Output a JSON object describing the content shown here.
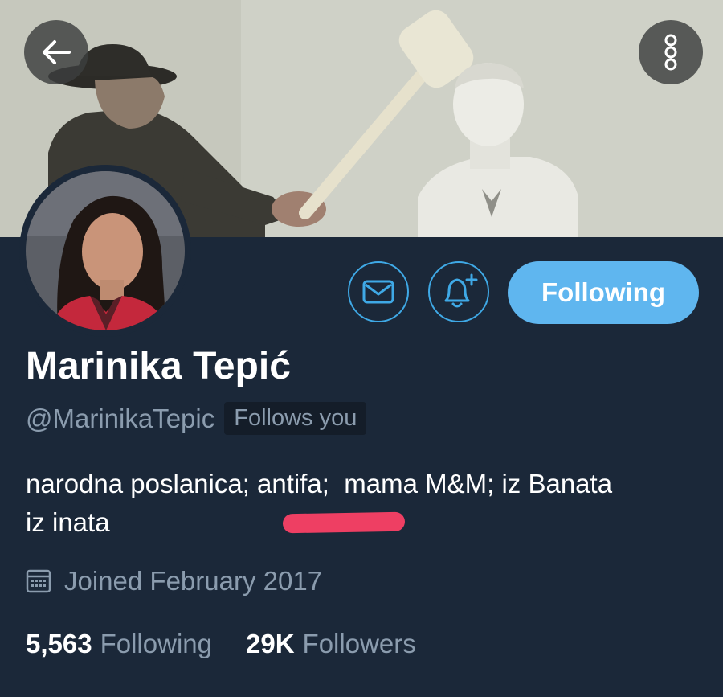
{
  "profile": {
    "name": "Marinika Tepić",
    "handle": "@MarinikaTepic",
    "follows_you": "Follows you",
    "bio": "narodna poslanica; antifa;  mama M&M; iz Banata\niz inata",
    "joined": "Joined February 2017"
  },
  "stats": {
    "following_count": "5,563",
    "following_label": "Following",
    "followers_count": "29K",
    "followers_label": "Followers"
  },
  "actions": {
    "follow_state_label": "Following"
  },
  "icons": {
    "back": "arrow-left-icon",
    "more": "more-vertical-icon",
    "message": "envelope-icon",
    "notify": "bell-plus-icon",
    "calendar": "calendar-icon"
  },
  "colors": {
    "background": "#1b2839",
    "accent": "#5fb6ef",
    "outline_accent": "#3fa9e6",
    "secondary_text": "#8b9cae",
    "highlight": "#ee3f63"
  }
}
